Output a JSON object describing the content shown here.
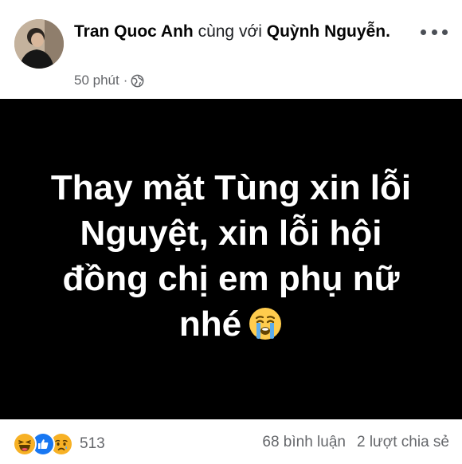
{
  "post": {
    "author": "Tran Quoc Anh",
    "with_text": "cùng với",
    "tagged": "Quỳnh Nguyễn.",
    "time": "50 phút",
    "dot": "·",
    "privacy_icon": "globe-icon",
    "more_icon": "more-options-icon",
    "content_lines": [
      "Thay mặt Tùng xin lỗi",
      "Nguyệt, xin lỗi hội",
      "đồng chị em phụ nữ",
      "nhé"
    ],
    "content_emoji": "crying-face-emoji",
    "background_color": "#000000",
    "text_color": "#ffffff"
  },
  "footer": {
    "reaction_icons": [
      "haha-icon",
      "like-icon",
      "sad-icon"
    ],
    "reaction_count": "513",
    "comments": "68 bình luận",
    "shares": "2 lượt chia sẻ"
  }
}
